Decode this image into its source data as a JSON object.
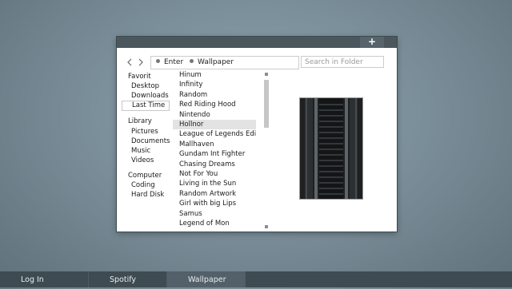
{
  "window": {
    "add_button_icon": "plus-icon",
    "address": {
      "back_icon": "chevron-left-icon",
      "forward_icon": "chevron-right-icon",
      "crumbs": [
        "Enter",
        "Wallpaper"
      ]
    },
    "search": {
      "placeholder": "Search in Folder"
    }
  },
  "sidebar": {
    "groups": [
      {
        "title": "Favorit",
        "items": [
          "Desktop",
          "Downloads",
          "Last Time"
        ],
        "selected_index": 2
      },
      {
        "title": "Library",
        "items": [
          "Pictures",
          "Documents",
          "Music",
          "Videos"
        ]
      },
      {
        "title": "Computer",
        "items": [
          "Coding",
          "Hard Disk"
        ]
      }
    ]
  },
  "files": {
    "items": [
      "Hinum",
      "Infinity",
      "Random",
      "Red Riding Hood",
      "Nintendo",
      "Hollnor",
      "League of Legends Edit",
      "Mallhaven",
      "Gundam Int Fighter",
      "Chasing Dreams",
      "Not For You",
      "Living in the Sun",
      "Random Artwork",
      "Girl with big Lips",
      "Samus",
      "Legend of Mon"
    ],
    "selected_index": 5
  },
  "preview": {
    "description_icon": "image-preview"
  },
  "taskbar": {
    "items": [
      "Log In",
      "Spotify",
      "Wallpaper"
    ],
    "active_index": 2
  },
  "colors": {
    "titlebar": "#4b565d",
    "taskbar": "#3f4b52",
    "taskbar_active": "#53606a",
    "selection": "#e3e3e3"
  }
}
